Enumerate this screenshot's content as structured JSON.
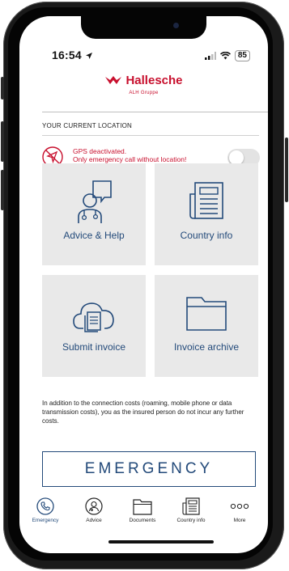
{
  "status_bar": {
    "time": "16:54",
    "battery": "85",
    "icons": [
      "location-arrow-icon",
      "signal-icon",
      "wifi-icon",
      "battery-icon"
    ]
  },
  "brand": {
    "name": "Hallesche",
    "tagline": "ALH Gruppe",
    "color": "#c8102e"
  },
  "location": {
    "heading": "YOUR CURRENT LOCATION",
    "gps_line1": "GPS deactivated.",
    "gps_line2": "Only emergency call without location!",
    "toggle_on": false
  },
  "tiles": [
    {
      "label": "Advice & Help",
      "icon": "doctor-advice-icon"
    },
    {
      "label": "Country info",
      "icon": "newspaper-icon"
    },
    {
      "label": "Submit invoice",
      "icon": "cloud-document-icon"
    },
    {
      "label": "Invoice archive",
      "icon": "folder-icon"
    }
  ],
  "info_text": "In addition to the connection costs (roaming, mobile phone or data transmission costs), you as the insured person do not incur any further costs.",
  "emergency_button": "EMERGENCY",
  "tabs": [
    {
      "label": "Emergency",
      "icon": "phone-icon",
      "active": true
    },
    {
      "label": "Advice",
      "icon": "doctor-icon",
      "active": false
    },
    {
      "label": "Documents",
      "icon": "folder-icon",
      "active": false
    },
    {
      "label": "Country info",
      "icon": "newspaper-icon",
      "active": false
    },
    {
      "label": "More",
      "icon": "more-icon",
      "active": false
    }
  ],
  "colors": {
    "accent_blue": "#234a7a",
    "brand_red": "#c8102e",
    "tile_bg": "#e9e9e9"
  }
}
